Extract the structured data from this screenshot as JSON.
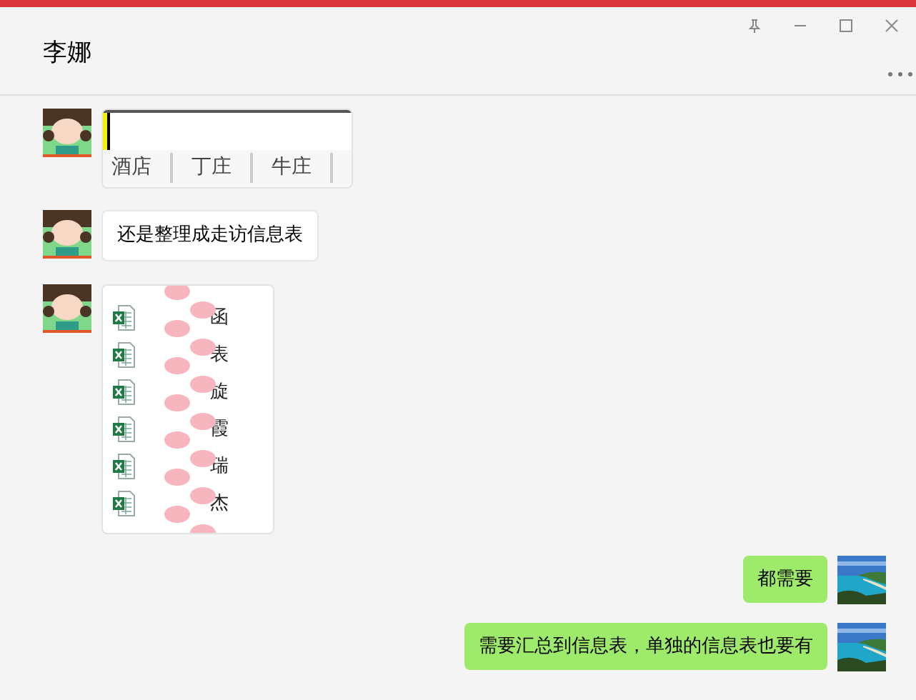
{
  "header": {
    "title": "李娜"
  },
  "messages": [
    {
      "outgoing": false,
      "kind": "screenshot",
      "tabs": [
        "酒店",
        "丁庄",
        "牛庄"
      ]
    },
    {
      "outgoing": false,
      "kind": "text",
      "text": "还是整理成走访信息表"
    },
    {
      "outgoing": false,
      "kind": "files",
      "files": [
        "函",
        "表",
        "旋",
        "霞",
        "瑞",
        "杰"
      ]
    },
    {
      "outgoing": true,
      "kind": "text",
      "text": "都需要"
    },
    {
      "outgoing": true,
      "kind": "text",
      "text": "需要汇总到信息表，单独的信息表也要有"
    }
  ]
}
